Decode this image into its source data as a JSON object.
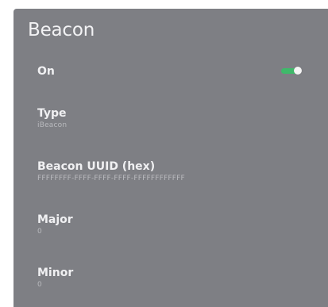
{
  "panel": {
    "title": "Beacon"
  },
  "on": {
    "label": "On",
    "state": true,
    "accent": "#3fb96a"
  },
  "type": {
    "label": "Type",
    "value": "iBeacon"
  },
  "uuid": {
    "label": "Beacon UUID (hex)",
    "value": "FFFFFFFF-FFFF-FFFF-FFFF-FFFFFFFFFFFF"
  },
  "major": {
    "label": "Major",
    "value": "0"
  },
  "minor": {
    "label": "Minor",
    "value": "0"
  }
}
